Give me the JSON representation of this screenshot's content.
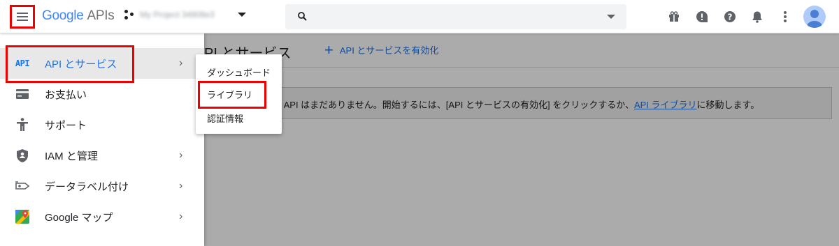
{
  "topbar": {
    "logo_google": "Google",
    "logo_apis": "APIs",
    "project_name": "My Project 34808e3",
    "search_value": "",
    "icons": [
      "menu-icon",
      "gift-icon",
      "feedback-icon",
      "help-icon",
      "notifications-icon",
      "more-vert-icon",
      "avatar"
    ]
  },
  "sidebar": {
    "items": [
      {
        "icon": "API",
        "label": "API とサービス",
        "chevron": "›"
      },
      {
        "label": "お支払い"
      },
      {
        "label": "サポート"
      },
      {
        "label": "IAM と管理",
        "chevron": "›"
      },
      {
        "label": "データラベル付け",
        "chevron": "›"
      },
      {
        "label": "Google マップ",
        "chevron": "›"
      }
    ]
  },
  "submenu": {
    "items": [
      "ダッシュボード",
      "ライブラリ",
      "認証情報"
    ]
  },
  "main": {
    "title": "PI とサービス",
    "enable_button": "API とサービスを有効化",
    "enable_plus": "+",
    "notice_pre": "る API はまだありません。開始するには、[API とサービスの有効化] をクリックするか、",
    "notice_link": "API ライブラリ",
    "notice_post": "に移動します。"
  },
  "colors": {
    "accent": "#1a73e8",
    "highlight": "#ee0000",
    "overlay": "rgba(0,0,0,0.33)"
  }
}
